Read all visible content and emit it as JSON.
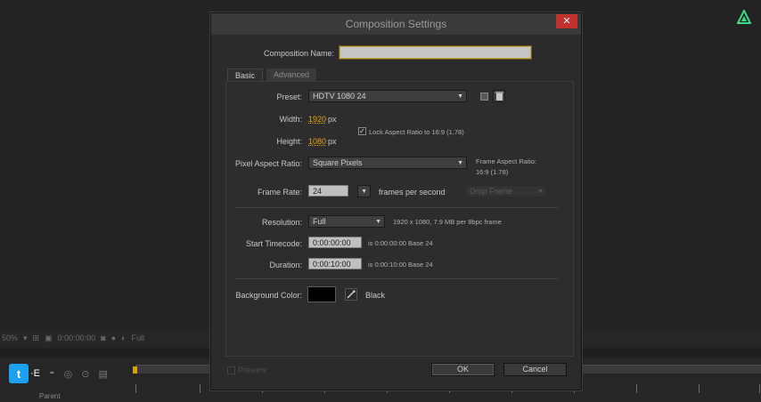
{
  "background": {
    "zoom": "50%",
    "timecode": "0:00:00:00",
    "quality": "Full",
    "parent_label": "Parent",
    "partial_text": "·E"
  },
  "dialog": {
    "title": "Composition Settings",
    "close_icon": "✕",
    "composition_name_label": "Composition Name:",
    "composition_name_value": "",
    "tabs": [
      {
        "label": "Basic",
        "active": true
      },
      {
        "label": "Advanced",
        "active": false
      }
    ],
    "preset": {
      "label": "Preset:",
      "value": "HDTV 1080 24"
    },
    "width": {
      "label": "Width:",
      "value": "1920",
      "unit": "px"
    },
    "height": {
      "label": "Height:",
      "value": "1080",
      "unit": "px"
    },
    "lock_aspect": {
      "label": "Lock Aspect Ratio to 16:9 (1.78)",
      "checked": true
    },
    "pixel_aspect": {
      "label": "Pixel Aspect Ratio:",
      "value": "Square Pixels",
      "frame_aspect_label": "Frame Aspect Ratio:",
      "frame_aspect_value": "16:9 (1.78)"
    },
    "frame_rate": {
      "label": "Frame Rate:",
      "value": "24",
      "unit": "frames per second",
      "drop_frame": "Drop Frame"
    },
    "resolution": {
      "label": "Resolution:",
      "value": "Full",
      "info": "1920 x 1080, 7.9 MB per 8bpc frame"
    },
    "start_timecode": {
      "label": "Start Timecode:",
      "value": "0:00:00:00",
      "info": "is 0:00:00:00  Base 24"
    },
    "duration": {
      "label": "Duration:",
      "value": "0:00:10:00",
      "info": "is 0:00:10:00  Base 24"
    },
    "background_color": {
      "label": "Background Color:",
      "name": "Black",
      "color": "#000000"
    },
    "preview_label": "Preview",
    "ok_label": "OK",
    "cancel_label": "Cancel"
  }
}
